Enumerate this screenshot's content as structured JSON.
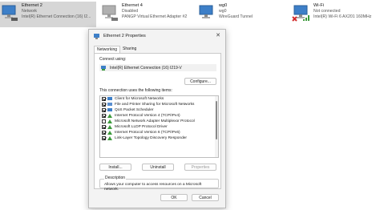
{
  "adapters": [
    {
      "name": "Ethernet 2",
      "status": "Network",
      "device": "Intel(R) Ethernet Connection (16) I2..."
    },
    {
      "name": "Ethernet 4",
      "status": "Disabled",
      "device": "PANGP Virtual Ethernet Adapter #2"
    },
    {
      "name": "wg0",
      "status": "wg0",
      "device": "WireGuard Tunnel"
    },
    {
      "name": "Wi-Fi",
      "status": "Not connected",
      "device": "Intel(R) Wi-Fi 6 AX201 160MHz"
    }
  ],
  "dialog": {
    "title": "Ethernet 2 Properties",
    "close_glyph": "✕",
    "tabs": [
      "Networking",
      "Sharing"
    ],
    "connect_using_label": "Connect using:",
    "adapter_name": "Intel(R) Ethernet Connection (16) I219-V",
    "configure_label": "Configure...",
    "items_label": "This connection uses the following items:",
    "items": [
      {
        "label": "Client for Microsoft Networks",
        "checked": true
      },
      {
        "label": "File and Printer Sharing for Microsoft Networks",
        "checked": true
      },
      {
        "label": "QoS Packet Scheduler",
        "checked": true
      },
      {
        "label": "Internet Protocol Version 4 (TCP/IPv4)",
        "checked": true
      },
      {
        "label": "Microsoft Network Adapter Multiplexor Protocol",
        "checked": false
      },
      {
        "label": "Microsoft LLDP Protocol Driver",
        "checked": true
      },
      {
        "label": "Internet Protocol Version 6 (TCP/IPv6)",
        "checked": true
      },
      {
        "label": "Link-Layer Topology Discovery Responder",
        "checked": true
      }
    ],
    "install_label": "Install...",
    "uninstall_label": "Uninstall",
    "properties_label": "Properties",
    "description_title": "Description",
    "description_text": "Allows your computer to access resources on a Microsoft network.",
    "ok_label": "OK",
    "cancel_label": "Cancel"
  },
  "colors": {
    "selected_bg": "#d6d6d6",
    "monitor_blue": "#3d7fc8",
    "error_red": "#d22c2c",
    "signal_green": "#3c9a3c"
  }
}
